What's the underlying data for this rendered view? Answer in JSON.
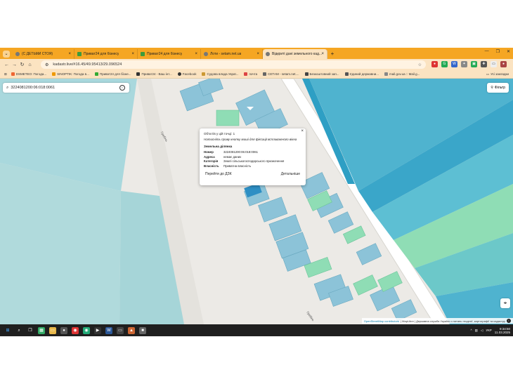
{
  "browser": {
    "tabs": [
      {
        "label": "(С ДЕТЬМИ СТОЯ)",
        "icon": "globe-icon",
        "active": false
      },
      {
        "label": "Приват24 для бізнесу",
        "icon": "privat-icon",
        "active": false
      },
      {
        "label": "Приват24 для бізнесу",
        "icon": "privat-icon",
        "active": false
      },
      {
        "label": "Лоти - setam.net.ua",
        "icon": "globe-icon",
        "active": false
      },
      {
        "label": "Відкриті дані земельного кад...",
        "icon": "globe-icon",
        "active": true
      }
    ],
    "new_tab": "+",
    "url": "kadastr.live/#16.45/49.95413/29.096524",
    "bookmarks": [
      "DSMETEO: Погода...",
      "SINOPTIK: Погода в...",
      "Приват24 для бізне...",
      "Приват24 - Ваш інт...",
      "Facebook",
      "Судова влада Украї...",
      "почта",
      "СЕТАМ - setam.net....",
      "Безкоштовний зап...",
      "Єдиний державни...",
      "mail.gov.ua :: Mail.g..."
    ],
    "all_bookmarks": "Усі закладки"
  },
  "map": {
    "search_value": "3224081200:06:018:0061",
    "filter_label": "Фільтр",
    "road_labels": [
      "Гребінь",
      "Гребінь"
    ],
    "attribution_osm": "OpenStreetMap contributors",
    "attribution_rest": "| MapLibre | Державна служба України з питань геодезії, картографії та кадастру",
    "attribution_i": "i",
    "popup": {
      "objects_line": "Об'єктів у цій точці: 1",
      "hint": "Натисніть праву кнопку миші для фіксації вспливаючого вікна",
      "section_title": "Земельна ділянка",
      "rows": [
        {
          "key": "Номер",
          "value": "3224081200:06:018:0061"
        },
        {
          "key": "Адреса",
          "value": "немає даних"
        },
        {
          "key": "Категорія",
          "value": "Землі сільськогосподарського призначення"
        },
        {
          "key": "Власність",
          "value": "Приватна власність"
        }
      ],
      "goto_label": "Перейти до ДЗК",
      "details_label": "Детальніше",
      "close": "×"
    }
  },
  "taskbar": {
    "language": "УКР",
    "time": "9:34:50",
    "date": "11.03.2025"
  },
  "colors": {
    "tabstrip": "#f5a623",
    "toolbar": "#fbe3c1",
    "parcel_blue": "#8cc3d8",
    "parcel_teal": "#5fb2cc",
    "parcel_dark": "#2e9fc4",
    "parcel_green": "#8fddb5"
  }
}
